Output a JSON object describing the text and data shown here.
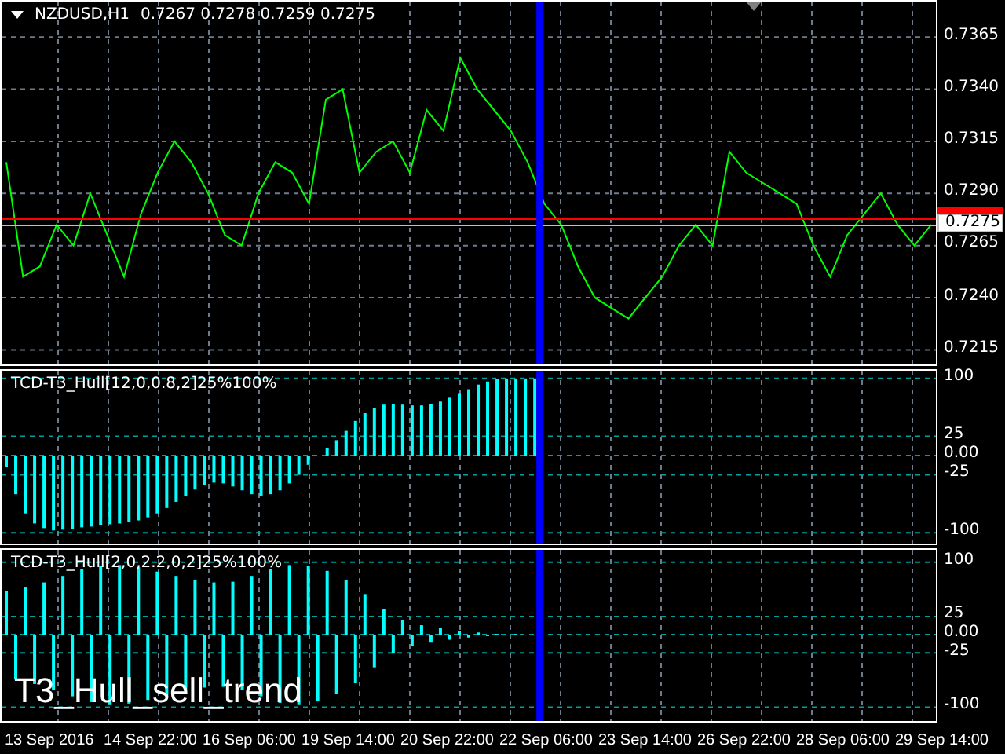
{
  "main_chart": {
    "symbol": "NZDUSD,H1",
    "quotes": "0.7267 0.7278 0.7259 0.7275",
    "chart_data": {
      "type": "line",
      "grid": true,
      "ylim": [
        0.7208,
        0.7382
      ],
      "yticks": [
        {
          "value": 0.7215,
          "label": "0.7215"
        },
        {
          "value": 0.724,
          "label": "0.7240"
        },
        {
          "value": 0.7265,
          "label": "0.7265"
        },
        {
          "value": 0.729,
          "label": "0.7290"
        },
        {
          "value": 0.7315,
          "label": "0.7315"
        },
        {
          "value": 0.734,
          "label": "0.7340"
        },
        {
          "value": 0.7365,
          "label": "0.7365"
        }
      ],
      "series": [
        {
          "color": "#00ff00",
          "values": [
            0.7305,
            0.725,
            0.7255,
            0.7275,
            0.7265,
            0.729,
            0.727,
            0.725,
            0.728,
            0.73,
            0.7315,
            0.7305,
            0.729,
            0.727,
            0.7265,
            0.729,
            0.7305,
            0.73,
            0.7285,
            0.7335,
            0.734,
            0.73,
            0.731,
            0.7315,
            0.73,
            0.733,
            0.732,
            0.7355,
            0.734,
            0.733,
            0.732,
            0.7305,
            0.7285,
            0.7275,
            0.7255,
            0.724,
            0.7235,
            0.723,
            0.724,
            0.725,
            0.7265,
            0.7275,
            0.7265,
            0.731,
            0.73,
            0.7295,
            0.729,
            0.7285,
            0.7265,
            0.725,
            0.727,
            0.728,
            0.729,
            0.7275,
            0.7265,
            0.7275
          ]
        }
      ]
    },
    "price_lines": [
      {
        "kind": "ask",
        "color": "#ff0000"
      },
      {
        "kind": "bid",
        "color": "#c0c0c0",
        "label": "0.7275"
      }
    ],
    "cursor_line": {
      "color": "#0000ff"
    }
  },
  "indicators": [
    {
      "label": "TCD-T3_Hull[12,0,0.8,2]25%100%",
      "chart_data": {
        "type": "bar",
        "grid": true,
        "ylim": [
          -114,
          110
        ],
        "yticks": [
          {
            "value": 100,
            "label": "100"
          },
          {
            "value": 25,
            "label": "25"
          },
          {
            "value": 0,
            "label": "0.00"
          },
          {
            "value": -25,
            "label": "-25"
          },
          {
            "value": -100,
            "label": "-100"
          }
        ],
        "series": [
          {
            "color": "#00ffff",
            "values": [
              -15,
              -50,
              -75,
              -88,
              -94,
              -97,
              -96,
              -95,
              -93,
              -92,
              -90,
              -89,
              -88,
              -86,
              -84,
              -80,
              -75,
              -68,
              -60,
              -52,
              -44,
              -38,
              -35,
              -36,
              -40,
              -45,
              -50,
              -52,
              -50,
              -45,
              -36,
              -25,
              -12,
              0,
              10,
              20,
              32,
              45,
              55,
              62,
              66,
              67,
              66,
              65,
              65,
              67,
              70,
              75,
              80,
              86,
              92,
              96,
              99,
              100,
              100,
              100,
              100,
              null,
              null,
              null,
              null,
              null,
              null,
              null,
              null,
              null,
              null,
              null,
              null,
              null,
              null,
              null,
              null,
              null,
              null,
              null,
              null,
              null,
              null,
              null,
              null,
              null,
              null,
              null,
              null,
              null,
              null,
              null,
              null,
              null,
              null,
              null,
              null,
              null,
              null,
              null,
              null,
              null,
              null
            ]
          }
        ]
      }
    },
    {
      "label": "TCD-T3_Hull[2,0,2.2,0,2]25%100%",
      "chart_data": {
        "type": "bar",
        "grid": true,
        "ylim": [
          -119,
          117
        ],
        "yticks": [
          {
            "value": 100,
            "label": "100"
          },
          {
            "value": 25,
            "label": "25"
          },
          {
            "value": 0,
            "label": "0.00"
          },
          {
            "value": -25,
            "label": "-25"
          },
          {
            "value": -100,
            "label": "-100"
          }
        ],
        "series": [
          {
            "color": "#00ffff",
            "values": [
              60,
              -62,
              65,
              -68,
              72,
              -76,
              80,
              -85,
              90,
              -93,
              95,
              -96,
              96,
              -95,
              93,
              -90,
              87,
              -84,
              80,
              -77,
              75,
              -73,
              72,
              -72,
              73,
              -76,
              80,
              -85,
              90,
              -94,
              96,
              -96,
              95,
              -92,
              88,
              -82,
              75,
              -66,
              56,
              -45,
              35,
              -26,
              20,
              -16,
              13,
              -11,
              9,
              -7,
              5,
              -4,
              3,
              -2,
              1,
              -1,
              1,
              0,
              0,
              null,
              null,
              null,
              null,
              null,
              null,
              null,
              null,
              null,
              null,
              null,
              null,
              null,
              null,
              null,
              null,
              null,
              null,
              null,
              null,
              null,
              null,
              null,
              null,
              null,
              null,
              null,
              null,
              null,
              null,
              null,
              null,
              null,
              null,
              null,
              null,
              null,
              null,
              null,
              null,
              null,
              null
            ]
          }
        ]
      }
    }
  ],
  "signal_text": "T3_Hull_sell_trend",
  "time_axis": [
    "13 Sep 2016",
    "14 Sep 22:00",
    "16 Sep 06:00",
    "19 Sep 14:00",
    "20 Sep 22:00",
    "22 Sep 06:00",
    "23 Sep 14:00",
    "26 Sep 22:00",
    "28 Sep 06:00",
    "29 Sep 14:00"
  ]
}
